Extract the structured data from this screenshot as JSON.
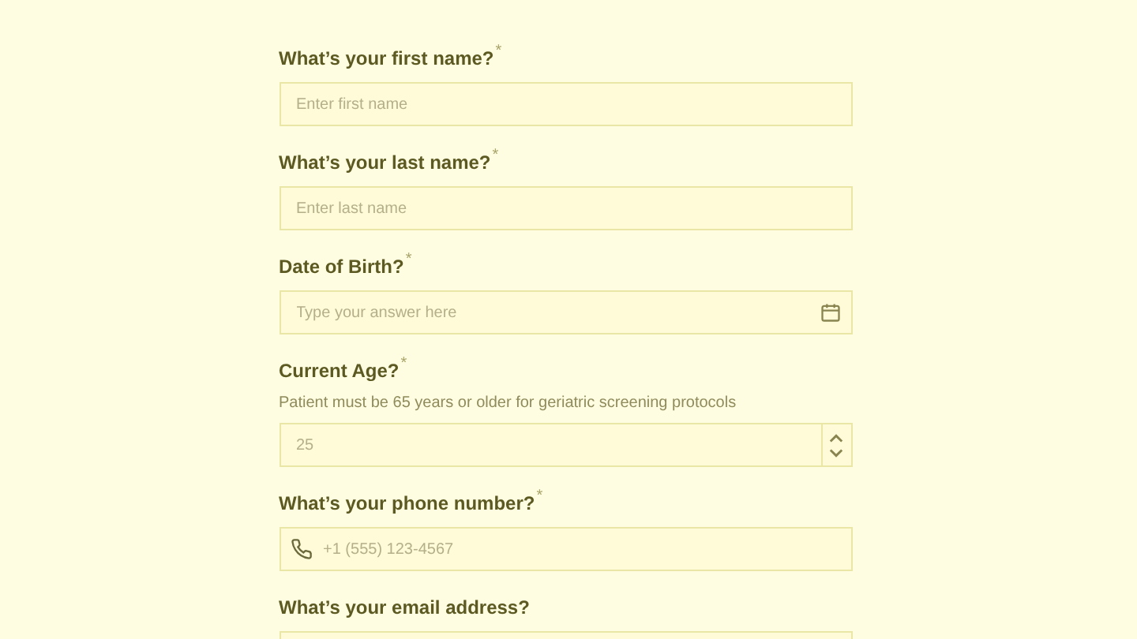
{
  "fields": [
    {
      "kind": "text",
      "label": "What’s your first name?",
      "required_mark": "*",
      "placeholder": "Enter first name"
    },
    {
      "kind": "text",
      "label": "What’s your last name?",
      "required_mark": "*",
      "placeholder": "Enter last name"
    },
    {
      "kind": "date",
      "label": "Date of Birth?",
      "required_mark": "*",
      "placeholder": "Type your answer here"
    },
    {
      "kind": "number",
      "label": "Current Age?",
      "required_mark": "*",
      "help": "Patient must be 65 years or older for geriatric screening protocols",
      "placeholder": "25"
    },
    {
      "kind": "phone",
      "label": "What’s your phone number?",
      "required_mark": "*",
      "placeholder": "+1 (555) 123-4567"
    },
    {
      "kind": "email",
      "label": "What’s your email address?"
    }
  ]
}
